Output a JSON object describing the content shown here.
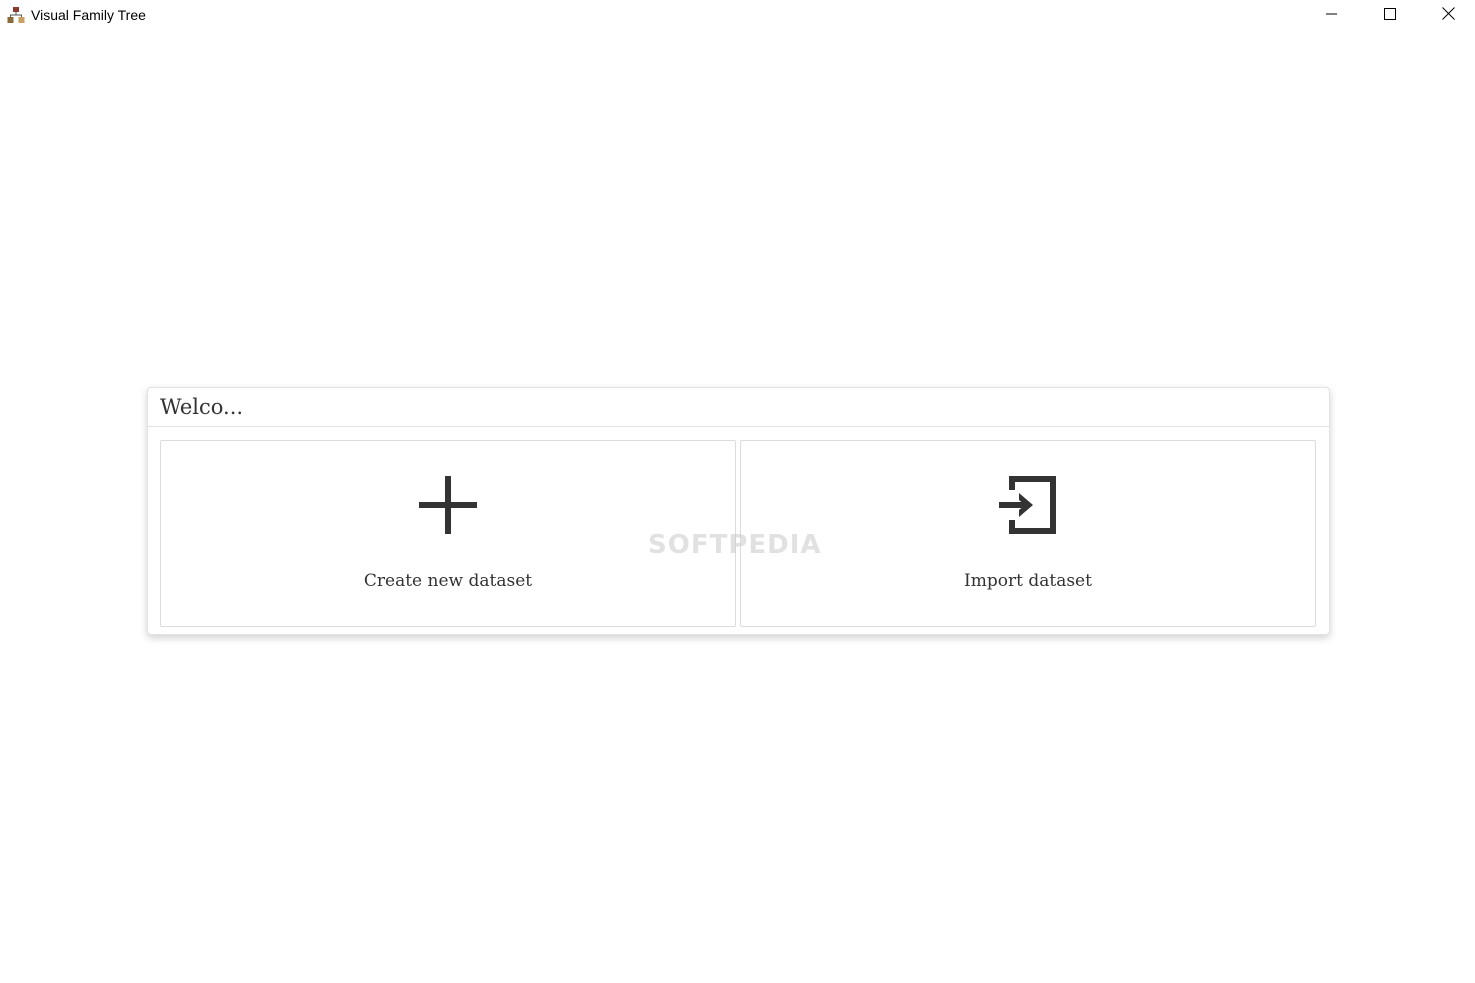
{
  "window": {
    "title": "Visual Family Tree",
    "app_icon": "family-tree-app-icon",
    "controls": {
      "minimize_icon": "minimize-icon",
      "maximize_icon": "maximize-icon",
      "close_icon": "close-icon"
    }
  },
  "welcome": {
    "title": "Welco...",
    "actions": [
      {
        "label": "Create new dataset",
        "icon": "plus-icon"
      },
      {
        "label": "Import dataset",
        "icon": "import-icon"
      }
    ]
  },
  "watermark": {
    "text": "SOFTPEDIA"
  },
  "colors": {
    "text": "#333333",
    "border": "#dcdcdc",
    "icon": "#333333",
    "background": "#ffffff"
  }
}
